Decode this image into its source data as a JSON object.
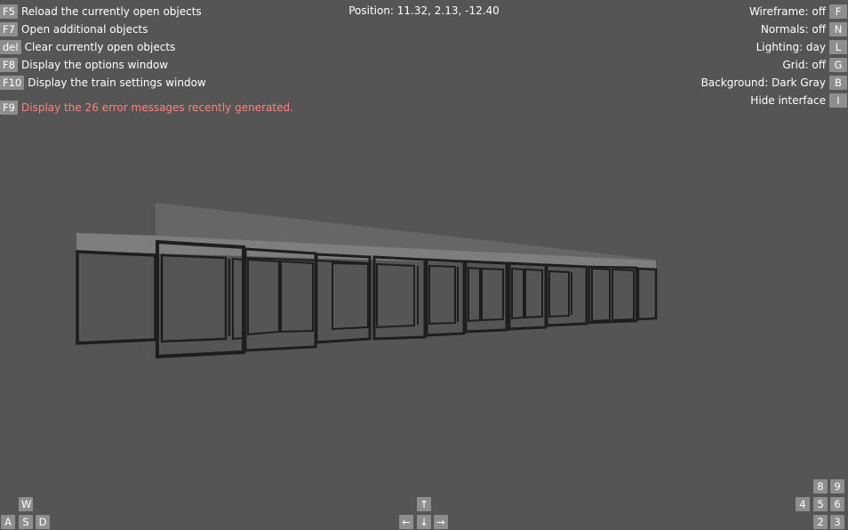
{
  "status": {
    "position": "Position: 11.32, 2.13, -12.40"
  },
  "left_menu": [
    {
      "key": "F5",
      "label": "Reload the currently open objects"
    },
    {
      "key": "F7",
      "label": "Open additional objects"
    },
    {
      "key": "del",
      "label": "Clear currently open objects"
    },
    {
      "key": "F8",
      "label": "Display the options window"
    },
    {
      "key": "F10",
      "label": "Display the train settings window"
    },
    {
      "key": "F9",
      "label": "Display the 26 error messages recently generated."
    }
  ],
  "right_menu": [
    {
      "key": "F",
      "label": "Wireframe: off"
    },
    {
      "key": "N",
      "label": "Normals: off"
    },
    {
      "key": "L",
      "label": "Lighting: day"
    },
    {
      "key": "G",
      "label": "Grid: off"
    },
    {
      "key": "B",
      "label": "Background: Dark Gray"
    },
    {
      "key": "I",
      "label": "Hide interface"
    }
  ],
  "movement_keys": {
    "w": "W",
    "a": "A",
    "s": "S",
    "d": "D"
  },
  "arrow_keys": {
    "up": "↑",
    "left": "←",
    "down": "↓",
    "right": "→"
  },
  "numpad_keys": {
    "n8": "8",
    "n9": "9",
    "n4": "4",
    "n5": "5",
    "n6": "6",
    "n2": "2",
    "n3": "3"
  },
  "colors": {
    "background": "#555555",
    "key_bg": "#8e8e8e",
    "error_text": "#ff8080",
    "frame": "#1e1e1e",
    "roof": "#7a7a7a"
  }
}
